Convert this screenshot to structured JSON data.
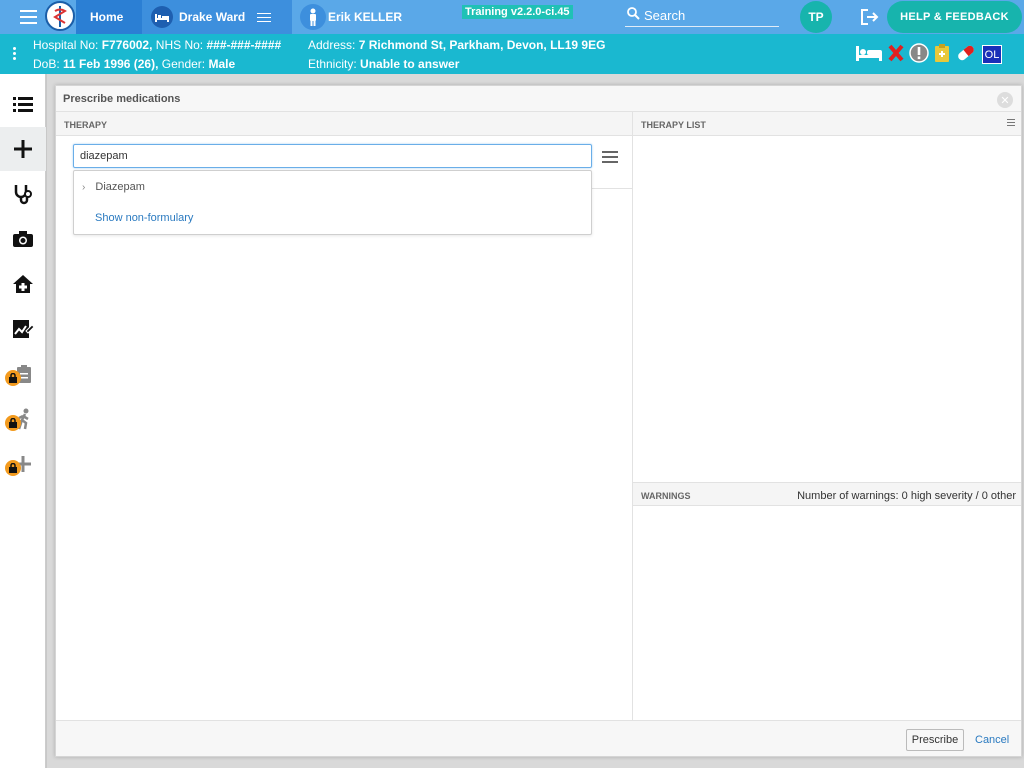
{
  "topnav": {
    "home_label": "Home",
    "ward_label": "Drake Ward",
    "patient_name": "Erik KELLER",
    "version_label": "Training v2.2.0-ci.45",
    "search_placeholder": "Search",
    "user_initials": "TP",
    "help_label": "HELP & FEEDBACK"
  },
  "banner": {
    "hospital_no_label": "Hospital No:",
    "hospital_no": "F776002,",
    "nhs_no_label": "NHS No:",
    "nhs_no": "###-###-####",
    "dob_label": "DoB:",
    "dob": "11 Feb 1996 (26),",
    "gender_label": "Gender:",
    "gender": "Male",
    "address_label": "Address:",
    "address": "7 Richmond St, Parkham, Devon, LL19 9EG",
    "ethnicity_label": "Ethnicity:",
    "ethnicity": "Unable to answer",
    "ol_badge": "OL"
  },
  "sidebar": {
    "items": [
      "list-icon",
      "plus-icon",
      "stethoscope-icon",
      "camera-icon",
      "home-plus-icon",
      "chart-edit-icon",
      "clipboard-icon",
      "walking-icon",
      "add-icon"
    ]
  },
  "modal": {
    "title": "Prescribe medications",
    "therapy_header": "THERAPY",
    "therapy_list_header": "THERAPY LIST",
    "search_value": "diazepam",
    "suggestion": "Diazepam",
    "show_non_formulary": "Show non-formulary",
    "warnings_header": "WARNINGS",
    "warnings_count": "Number of warnings: 0 high severity / 0 other",
    "prescribe_label": "Prescribe",
    "cancel_label": "Cancel"
  },
  "colors": {
    "topbar": "#5aa8e8",
    "banner": "#1ab8d0",
    "accent": "#17b4ad",
    "link": "#2a7ac0"
  }
}
